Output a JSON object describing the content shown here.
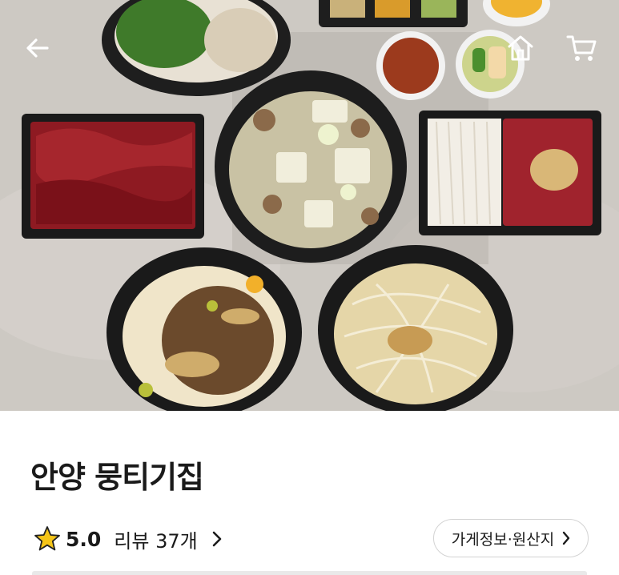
{
  "header": {
    "back_icon": "arrow-left-icon",
    "home_icon": "home-icon",
    "cart_icon": "cart-icon"
  },
  "hero": {
    "description": "overhead food photo with bowls of noodles, soup, raw beef and sides"
  },
  "store": {
    "name": "안양 뭉티기집",
    "rating": "5.0",
    "review_label": "리뷰 37개",
    "info_button_label": "가게정보·원산지"
  },
  "colors": {
    "star": "#f5c518",
    "text": "#1a1a1a",
    "border": "#d3d3d3"
  }
}
